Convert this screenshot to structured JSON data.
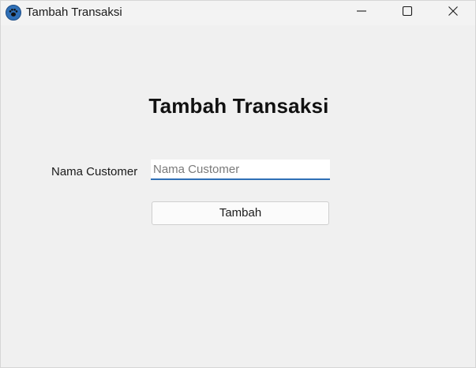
{
  "window": {
    "title": "Tambah Transaksi",
    "icon": "paw-icon",
    "controls": [
      "minimize-icon",
      "maximize-icon",
      "close-icon"
    ]
  },
  "form": {
    "heading": "Tambah Transaksi",
    "customer_label": "Nama Customer",
    "customer_input": {
      "value": "",
      "placeholder": "Nama Customer"
    },
    "submit_label": "Tambah"
  },
  "colors": {
    "background": "#f0f0f0",
    "accent": "#2f6fb6",
    "button_bg": "#fbfbfb"
  }
}
